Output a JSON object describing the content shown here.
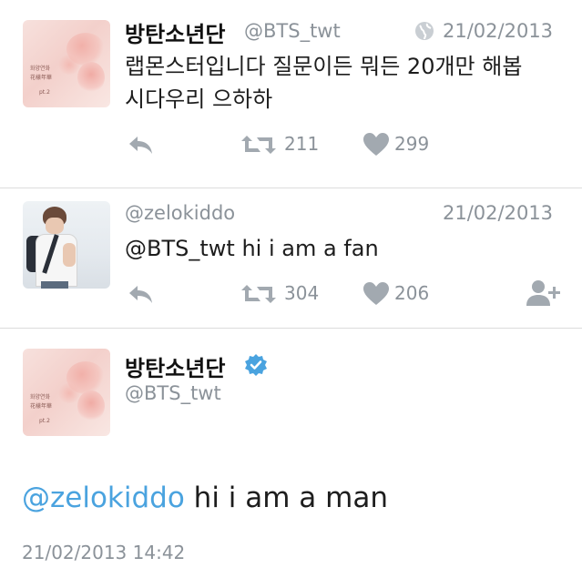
{
  "tweet1": {
    "name": "방탄소년단",
    "handle": "@BTS_twt",
    "date": "21/02/2013",
    "text_line1": "랩몬스터입니다 질문이든 뭐든 20개만 해봅",
    "text_line2": "시다우리 으하하",
    "retweets": "211",
    "likes": "299",
    "cover_text_line1": "화양연화",
    "cover_text_line2": "花樣年華",
    "cover_text_line3": "pt.2"
  },
  "tweet2": {
    "handle": "@zelokiddo",
    "date": "21/02/2013",
    "text": "@BTS_twt hi i am a fan",
    "retweets": "304",
    "likes": "206"
  },
  "tweet3": {
    "name": "방탄소년단",
    "handle": "@BTS_twt",
    "mention": "@zelokiddo",
    "text": " hi i am a man",
    "timestamp": "21/02/2013 14:42",
    "cover_text_line1": "화양연화",
    "cover_text_line2": "花樣年華",
    "cover_text_line3": "pt.2"
  },
  "colors": {
    "link": "#4aa3df",
    "verified": "#4aa3df",
    "secondary_text": "#8b9299",
    "divider": "#dcdcdc"
  },
  "icons": [
    "globe-icon",
    "reply-icon",
    "retweet-icon",
    "heart-icon",
    "follow-icon",
    "verified-badge-icon"
  ]
}
